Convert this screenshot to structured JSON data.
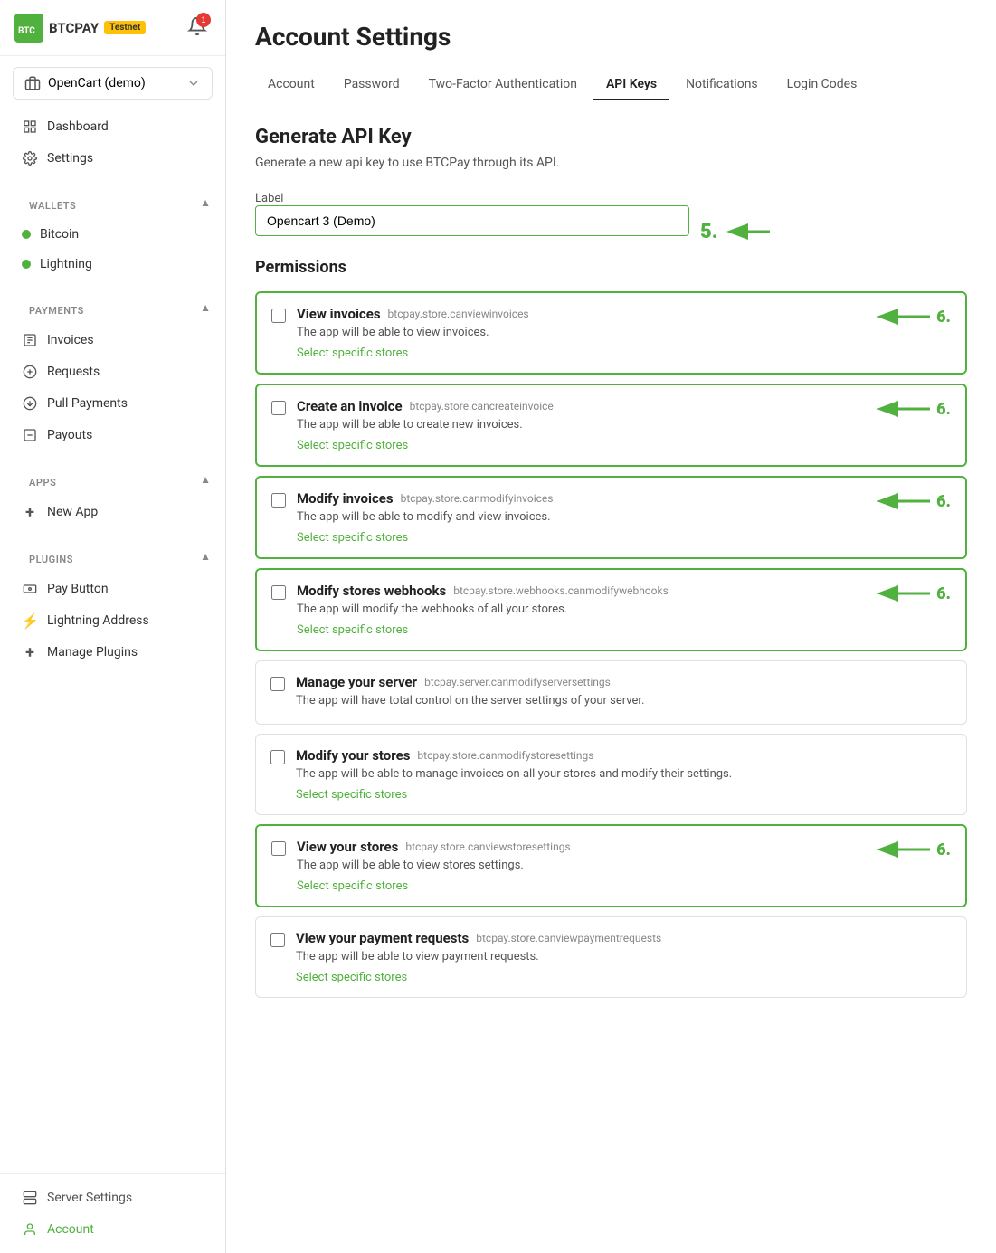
{
  "sidebar": {
    "logo_text": "BTCPAY",
    "testnet_label": "Testnet",
    "notification_count": "1",
    "store_selector": {
      "label": "OpenCart (demo)",
      "icon": "store-icon"
    },
    "nav_items": [
      {
        "id": "dashboard",
        "label": "Dashboard",
        "icon": "dashboard-icon"
      },
      {
        "id": "settings",
        "label": "Settings",
        "icon": "settings-icon"
      }
    ],
    "wallets_label": "WALLETS",
    "wallets": [
      {
        "id": "bitcoin",
        "label": "Bitcoin"
      },
      {
        "id": "lightning",
        "label": "Lightning"
      }
    ],
    "payments_label": "PAYMENTS",
    "payment_items": [
      {
        "id": "invoices",
        "label": "Invoices",
        "icon": "invoices-icon"
      },
      {
        "id": "requests",
        "label": "Requests",
        "icon": "requests-icon"
      },
      {
        "id": "pull-payments",
        "label": "Pull Payments",
        "icon": "pull-payments-icon"
      },
      {
        "id": "payouts",
        "label": "Payouts",
        "icon": "payouts-icon"
      }
    ],
    "apps_label": "APPS",
    "app_items": [
      {
        "id": "new-app",
        "label": "New App",
        "icon": "plus-icon"
      }
    ],
    "plugins_label": "PLUGINS",
    "plugin_items": [
      {
        "id": "pay-button",
        "label": "Pay Button",
        "icon": "pay-button-icon"
      },
      {
        "id": "lightning-address",
        "label": "Lightning Address",
        "icon": "lightning-icon"
      },
      {
        "id": "manage-plugins",
        "label": "Manage Plugins",
        "icon": "plus-icon"
      }
    ],
    "bottom_items": [
      {
        "id": "server-settings",
        "label": "Server Settings",
        "icon": "server-icon"
      },
      {
        "id": "account",
        "label": "Account",
        "icon": "account-icon",
        "active": true
      }
    ]
  },
  "header": {
    "title": "Account Settings"
  },
  "tabs": [
    {
      "id": "account",
      "label": "Account",
      "active": false
    },
    {
      "id": "password",
      "label": "Password",
      "active": false
    },
    {
      "id": "two-factor",
      "label": "Two-Factor Authentication",
      "active": false
    },
    {
      "id": "api-keys",
      "label": "API Keys",
      "active": true
    },
    {
      "id": "notifications",
      "label": "Notifications",
      "active": false
    },
    {
      "id": "login-codes",
      "label": "Login Codes",
      "active": false
    }
  ],
  "generate_section": {
    "title": "Generate API Key",
    "description": "Generate a new api key to use BTCPay through its API.",
    "label_field": "Label",
    "label_value": "Opencart 3 (Demo)",
    "label_placeholder": "Label"
  },
  "permissions_title": "Permissions",
  "permissions": [
    {
      "id": "view-invoices",
      "name": "View invoices",
      "code": "btcpay.store.canviewinvoices",
      "description": "The app will be able to view invoices.",
      "link_text": "Select specific stores",
      "highlighted": true
    },
    {
      "id": "create-invoice",
      "name": "Create an invoice",
      "code": "btcpay.store.cancreateinvoice",
      "description": "The app will be able to create new invoices.",
      "link_text": "Select specific stores",
      "highlighted": true
    },
    {
      "id": "modify-invoices",
      "name": "Modify invoices",
      "code": "btcpay.store.canmodifyinvoices",
      "description": "The app will be able to modify and view invoices.",
      "link_text": "Select specific stores",
      "highlighted": true
    },
    {
      "id": "modify-webhooks",
      "name": "Modify stores webhooks",
      "code": "btcpay.store.webhooks.canmodifywebhooks",
      "description": "The app will modify the webhooks of all your stores.",
      "link_text": "Select specific stores",
      "highlighted": true
    },
    {
      "id": "manage-server",
      "name": "Manage your server",
      "code": "btcpay.server.canmodifyserversettings",
      "description": "The app will have total control on the server settings of your server.",
      "link_text": null,
      "highlighted": false
    },
    {
      "id": "modify-stores",
      "name": "Modify your stores",
      "code": "btcpay.store.canmodifystoresettings",
      "description": "The app will be able to manage invoices on all your stores and modify their settings.",
      "link_text": "Select specific stores",
      "highlighted": false
    },
    {
      "id": "view-stores",
      "name": "View your stores",
      "code": "btcpay.store.canviewstoresettings",
      "description": "The app will be able to view stores settings.",
      "link_text": "Select specific stores",
      "highlighted": true
    },
    {
      "id": "view-payment-requests",
      "name": "View your payment requests",
      "code": "btcpay.store.canviewpaymentrequests",
      "description": "The app will be able to view payment requests.",
      "link_text": "Select specific stores",
      "highlighted": false
    }
  ],
  "annotations": {
    "label_arrow": "5.",
    "permission_arrows": "6."
  }
}
